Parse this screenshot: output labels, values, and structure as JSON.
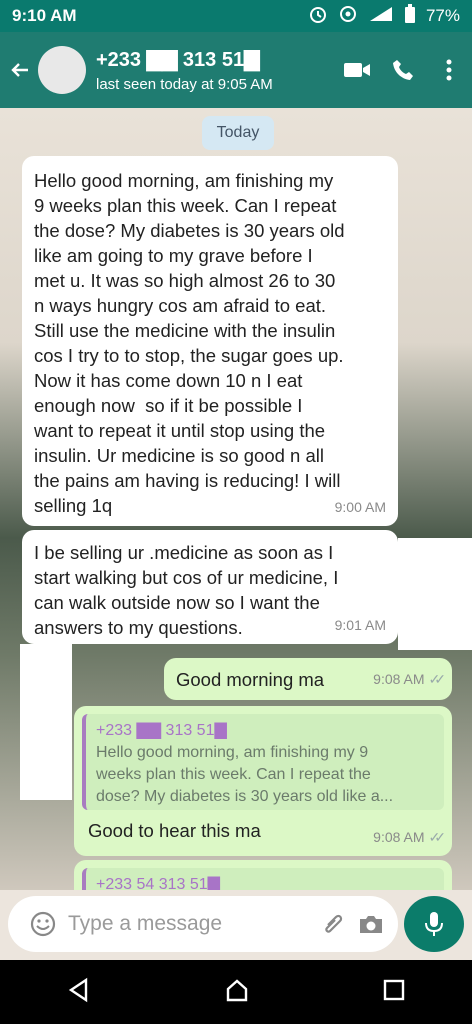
{
  "status_bar": {
    "time": "9:10 AM",
    "battery": "77%"
  },
  "header": {
    "contact_name": "+233 ▇▇ 313 51▇",
    "status": "last seen today at 9:05 AM"
  },
  "chat": {
    "date_chip": "Today",
    "messages": [
      {
        "text": "Hello good morning, am finishing my\n9 weeks plan this week. Can I repeat\nthe dose? My diabetes is 30 years old\nlike am going to my grave before I\nmet u. It was so high almost 26 to 30\nn ways hungry cos am afraid to eat.\nStill use the medicine with the insulin\ncos I try to to stop, the sugar goes up.\nNow it has come down 10 n I eat\nenough now  so if it be possible I\nwant to repeat it until stop using the\ninsulin. Ur medicine is so good n all\nthe pains am having is reducing! I will\nselling 1q",
        "time": "9:00 AM"
      },
      {
        "text": "I be selling ur .medicine as soon as I\nstart walking but cos of ur medicine, I\ncan walk outside now so I want the\nanswers to my questions.",
        "time": "9:01 AM"
      },
      {
        "text": "Good morning ma",
        "time": "9:08 AM"
      },
      {
        "quote_name": "+233 ▇▇ 313 51▇",
        "quote_text": "Hello good morning, am finishing my 9\nweeks plan this week. Can I repeat the\ndose? My diabetes is 30 years old like a...",
        "text": "Good to hear this ma",
        "time": "9:08 AM"
      },
      {
        "quote_name": "+233 54 313 51▇"
      }
    ]
  },
  "composer": {
    "placeholder": "Type a message"
  },
  "colors": {
    "header": "#1f7c71",
    "outgoing": "#dcf8c6",
    "incoming": "#ffffff",
    "mic": "#0b7c6a"
  }
}
